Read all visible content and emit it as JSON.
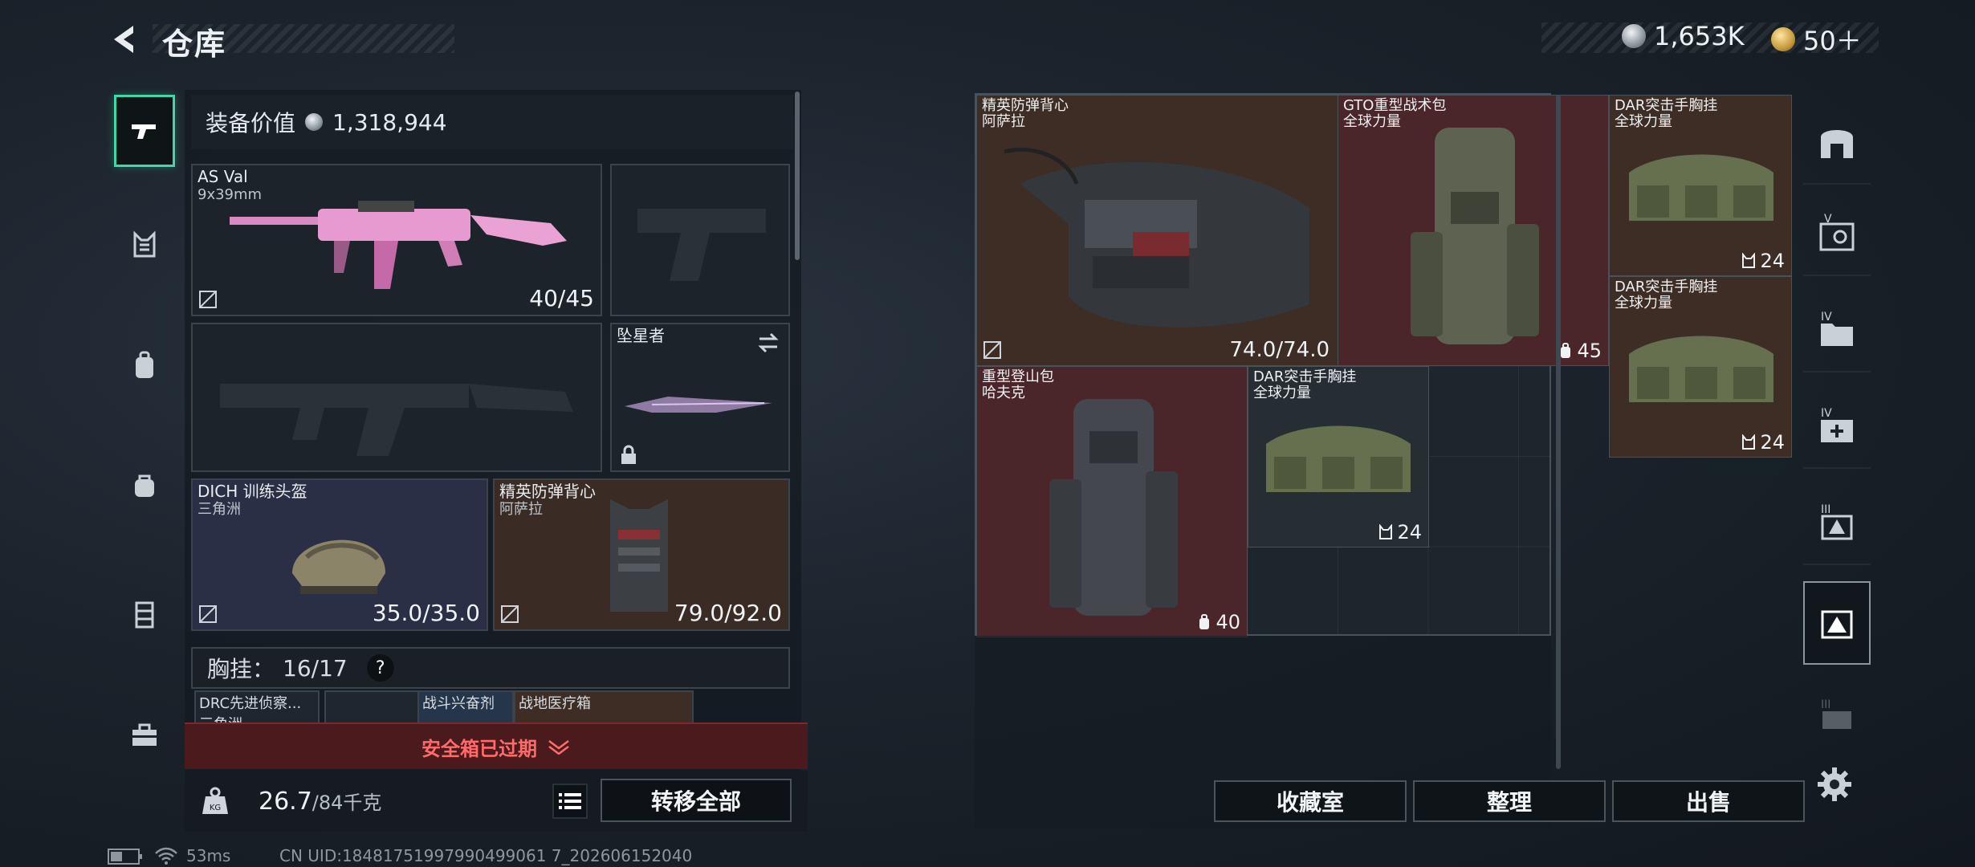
{
  "header": {
    "title": "仓库",
    "currencies": [
      {
        "icon": "silver-coin-icon",
        "value": "1,653K"
      },
      {
        "icon": "gold-coin-icon",
        "value": "50＋"
      }
    ]
  },
  "loadout": {
    "equipment_value_label": "装备价值",
    "equipment_value": "1,318,944",
    "primary_weapon": {
      "name": "AS Val",
      "ammo": "9x39mm",
      "durability": "40/45"
    },
    "helmet": {
      "name": "DICH 训练头盔",
      "brand": "三角洲",
      "durability": "35.0/35.0"
    },
    "armor": {
      "name": "精英防弹背心",
      "brand": "阿萨拉",
      "durability": "79.0/92.0"
    },
    "melee": {
      "name": "坠星者"
    },
    "chest_rig_label": "胸挂：",
    "chest_rig_capacity": "16/17",
    "help": "?",
    "chest_items": [
      {
        "name": "DRC先进侦察..."
      },
      {
        "name": "三角洲"
      },
      {
        "name": "战斗兴奋剂"
      },
      {
        "name": "战地医疗箱"
      }
    ],
    "safe_box_expired": "安全箱已过期",
    "weight_current": "26.7",
    "weight_max": "/84千克",
    "transfer_all": "转移全部"
  },
  "storage": {
    "items": [
      {
        "name": "精英防弹背心",
        "brand": "阿萨拉",
        "durability": "74.0/74.0"
      },
      {
        "name": "GTO重型战术包",
        "brand": "全球力量",
        "count": "45"
      },
      {
        "name": "DAR突击手胸挂",
        "brand": "全球力量",
        "count": "24"
      },
      {
        "name": "DAR突击手胸挂",
        "brand": "全球力量",
        "count": "24"
      },
      {
        "name": "重型登山包",
        "brand": "哈夫克",
        "count": "40"
      },
      {
        "name": "DAR突击手胸挂",
        "brand": "全球力量",
        "count": "24"
      }
    ],
    "buttons": {
      "collection": "收藏室",
      "organize": "整理",
      "sell": "出售"
    }
  },
  "right_nav": {
    "tiers": [
      "V",
      "IV",
      "IV",
      "III",
      "III"
    ]
  },
  "status_bar": {
    "ping": "53ms",
    "uid": "CN UID:18481751997990499061 7_202606152040"
  },
  "colors": {
    "accent": "#3dd9a8",
    "warning": "#ff6b6b",
    "rarity_brown": "#3d2d24",
    "rarity_red": "#4a252a"
  }
}
